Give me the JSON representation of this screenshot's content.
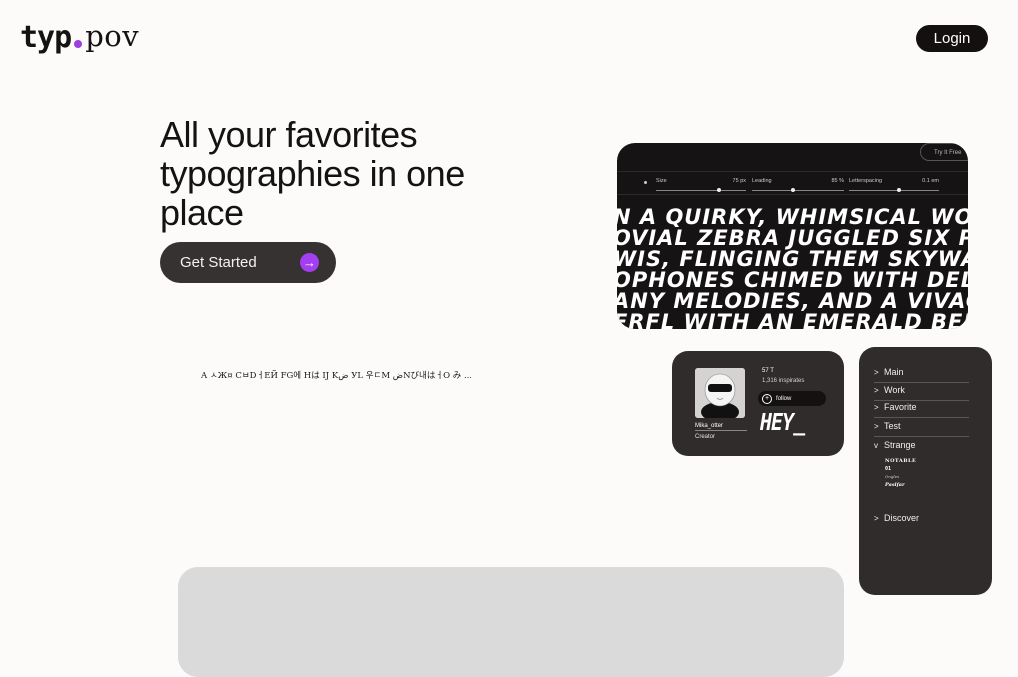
{
  "brand": {
    "logo_left": "typ",
    "logo_right": "pov",
    "accent": "#9b3fe0"
  },
  "header": {
    "login_label": "Login"
  },
  "hero": {
    "title": "All your favorites typographies in one place",
    "cta_label": "Get Started",
    "cta_icon": "arrow-right-icon"
  },
  "glyph_strip": "A ㅅЖ¤ CㅂDㅓEЙ FG에 Hは IJ Kض УL 우ㄷM ضNび내はㅓO み ...",
  "preview": {
    "try_free_label": "Try It Free",
    "controls": [
      {
        "label": "Size",
        "value": "75",
        "unit": "px",
        "level": 0.7
      },
      {
        "label": "Leading",
        "value": "85",
        "unit": "%",
        "level": 0.45
      },
      {
        "label": "Letterspacing",
        "value": "0.1",
        "unit": "em",
        "level": 0.55
      }
    ],
    "sample_lines": [
      "N A QUIRKY, WHIMSICAL WORLD",
      "OVIAL ZEBRA JUGGLED SIX PLU",
      "WIS, FLINGING THEM SKYWARD",
      "OPHONES CHIMED WITH DELIGH",
      "ANY MELODIES, AND A VIVACIO",
      "ERFL WITH AN EMERALD BERET"
    ]
  },
  "profile": {
    "name": "Mika_otter",
    "role": "Creator",
    "count": "57 T",
    "inspirations": "1,316 inspirates",
    "follow_label": "follow",
    "signature": "HEY_"
  },
  "sidebar": {
    "items": [
      {
        "label": "Main",
        "chevron": ">"
      },
      {
        "label": "Work",
        "chevron": ">"
      },
      {
        "label": "Favorite",
        "chevron": ">"
      },
      {
        "label": "Test",
        "chevron": ">"
      },
      {
        "label": "Strange",
        "chevron": "v"
      }
    ],
    "fav_fonts": [
      "NOTABLE",
      "01",
      "Ongles",
      "Paslfar"
    ],
    "discover": {
      "label": "Discover",
      "chevron": ">"
    }
  }
}
